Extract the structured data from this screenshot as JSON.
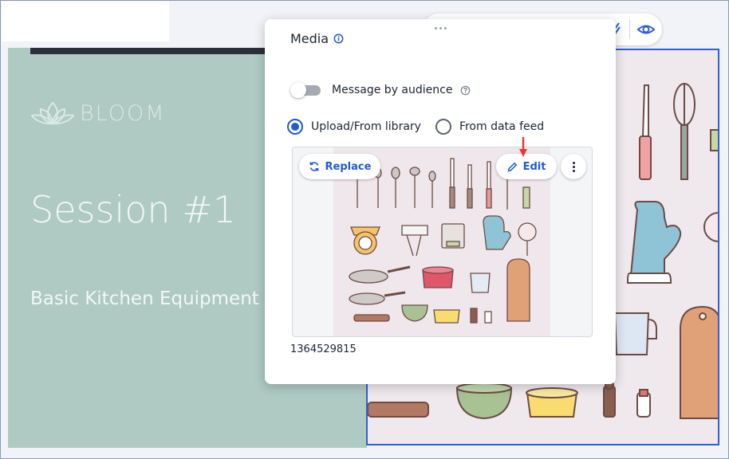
{
  "slide": {
    "logo_text": "BLOOM",
    "title": "Session #1",
    "subtitle": "Basic Kitchen Equipment"
  },
  "media_panel": {
    "title": "Media",
    "toggle_label": "Message by audience",
    "toggle_on": false,
    "source_options": [
      {
        "label": "Upload/From library",
        "selected": true
      },
      {
        "label": "From data feed",
        "selected": false
      }
    ],
    "replace_label": "Replace",
    "edit_label": "Edit",
    "file_name": "1364529815"
  },
  "colors": {
    "accent": "#1f5bd6",
    "slide_green": "#afc9c3",
    "image_bg": "#efe9ee",
    "annotation_arrow": "#e53935"
  },
  "icons": {
    "info": "info-icon",
    "help": "question-circle-icon",
    "replace": "refresh-icon",
    "edit": "pencil-icon",
    "more": "vertical-dots-icon",
    "preview": "eye-icon",
    "drag": "drag-handle-icon"
  }
}
